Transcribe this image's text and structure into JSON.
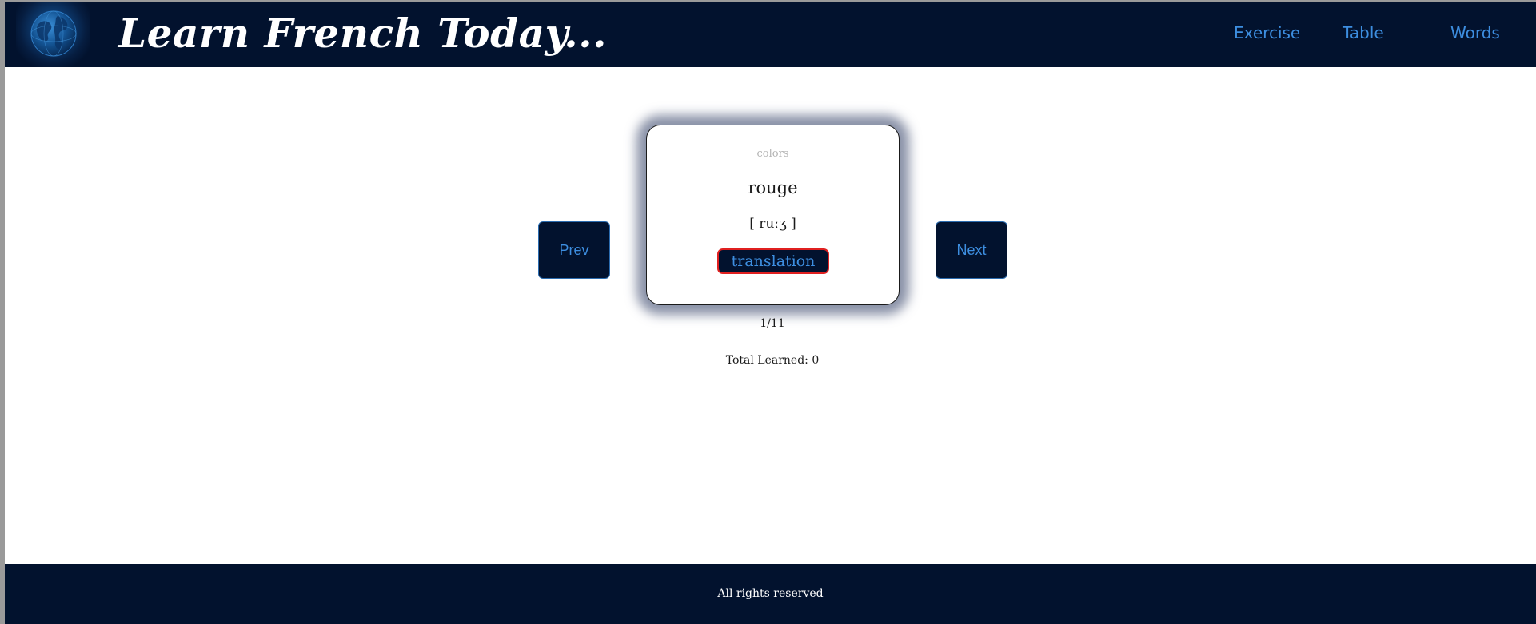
{
  "header": {
    "title": "Learn French Today...",
    "nav": {
      "exercise": "Exercise",
      "table": "Table",
      "words": "Words"
    }
  },
  "card": {
    "category": "colors",
    "word": "rouge",
    "phonetic": "[ ruːʒ ]",
    "translation_button": "translation"
  },
  "controls": {
    "prev": "Prev",
    "next": "Next"
  },
  "progress": {
    "counter": "1/11",
    "total_learned": "Total Learned: 0"
  },
  "footer": {
    "text": "All rights reserved"
  },
  "icons": {
    "logo": "globe-icon"
  },
  "colors": {
    "navy": "#02122e",
    "accent_blue": "#3d8ee0",
    "highlight_red": "#e02020",
    "white": "#ffffff"
  }
}
